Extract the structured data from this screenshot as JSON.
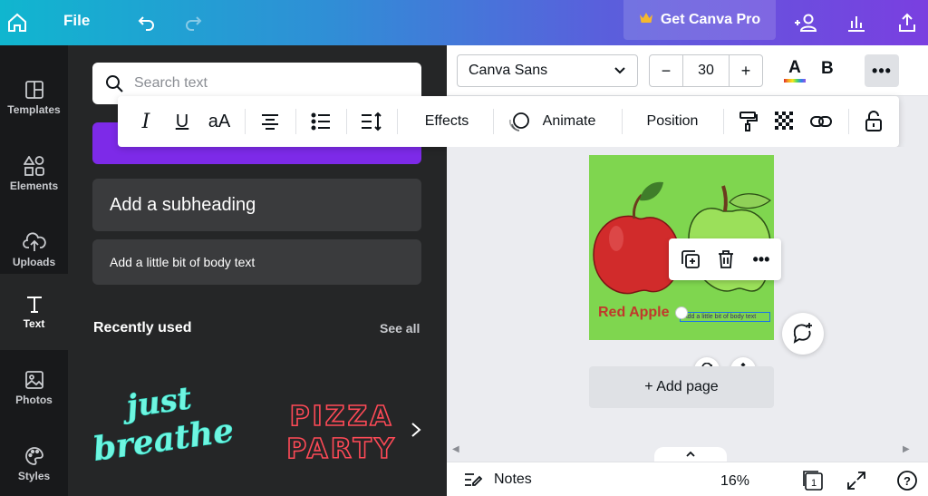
{
  "topbar": {
    "file_label": "File",
    "pro_label": "Get Canva Pro",
    "icons": [
      "home-icon",
      "undo-icon",
      "redo-icon",
      "crown-icon",
      "add-people-icon",
      "analytics-icon",
      "share-upload-icon"
    ]
  },
  "rail": {
    "items": [
      {
        "label": "Templates",
        "icon": "templates-icon"
      },
      {
        "label": "Elements",
        "icon": "elements-icon"
      },
      {
        "label": "Uploads",
        "icon": "uploads-icon"
      },
      {
        "label": "Text",
        "icon": "text-icon",
        "active": true
      },
      {
        "label": "Photos",
        "icon": "photos-icon"
      },
      {
        "label": "Styles",
        "icon": "styles-icon"
      }
    ]
  },
  "panel": {
    "search_placeholder": "Search text",
    "subheading": "Add a subheading",
    "body_text": "Add a little bit of body text",
    "recent_title": "Recently used",
    "see_all": "See all",
    "recent_items": [
      "just breathe",
      "PIZZA PARTY"
    ]
  },
  "editor_toolbar": {
    "font_name": "Canva Sans",
    "font_size": "30",
    "minus": "−",
    "plus": "+",
    "font_color_letter": "A",
    "bold_letter": "B",
    "more": "•••"
  },
  "text_toolbar": {
    "italic": "I",
    "underline": "U",
    "case": "aA",
    "effects": "Effects",
    "animate": "Animate",
    "position": "Position"
  },
  "canvas": {
    "heading_text": "Red Apple",
    "body_text": "Add a little bit of body text",
    "add_page": "+ Add page",
    "context_more": "•••"
  },
  "bottombar": {
    "notes": "Notes",
    "zoom": "16%",
    "page_number": "1",
    "help": "?"
  },
  "colors": {
    "topbar_start": "#10b6cf",
    "topbar_end": "#7a3fe0",
    "rail_bg": "#18191b",
    "panel_bg": "#252627",
    "purple_button": "#7d2ae8",
    "page_green": "#7fd64f",
    "red_apple": "#c0392b"
  }
}
